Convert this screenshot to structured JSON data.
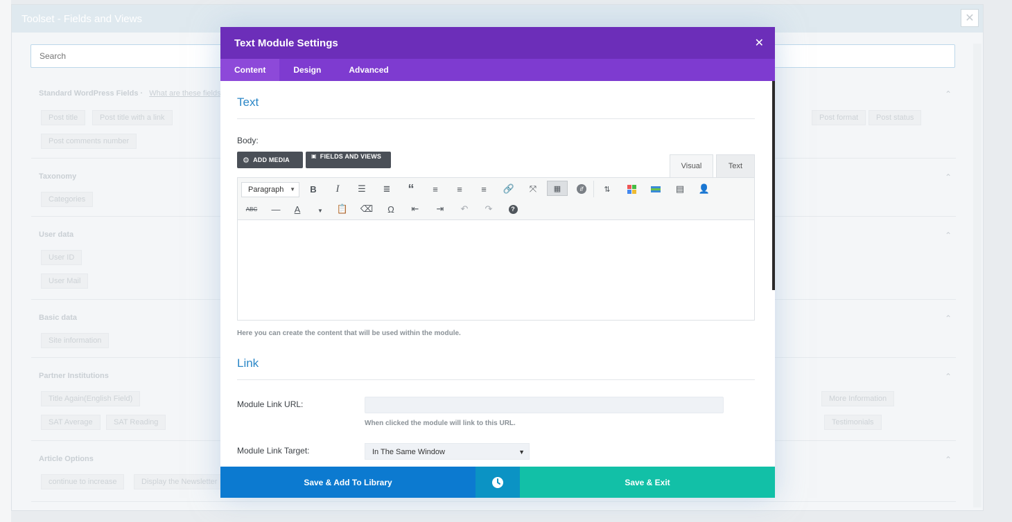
{
  "background_dialog": {
    "title": "Toolset - Fields and Views",
    "close_label": "✕",
    "search_placeholder": "Search",
    "sections": [
      {
        "title": "Standard WordPress Fields",
        "link": "What are these fields?",
        "chips": [
          "Post title",
          "Post title with a link",
          "Post comments number",
          "Post format",
          "Post status"
        ]
      },
      {
        "title": "Taxonomy",
        "chips": [
          "Categories"
        ]
      },
      {
        "title": "User data",
        "chips": [
          "User ID",
          "User Mail"
        ]
      },
      {
        "title": "Basic data",
        "chips": [
          "Site information"
        ]
      },
      {
        "title": "Partner Institutions",
        "chips": [
          "Title Again(English Field)",
          "More Information",
          "SAT Average",
          "SAT Reading",
          "Testimonials"
        ]
      },
      {
        "title": "Article Options",
        "chips": [
          "continue to increase",
          "Display the Newsletter"
        ]
      }
    ]
  },
  "modal": {
    "title": "Text Module Settings",
    "close_label": "✕",
    "tabs": [
      "Content",
      "Design",
      "Advanced"
    ],
    "active_tab": "Content",
    "text_section": {
      "heading": "Text",
      "body_label": "Body:",
      "add_media_label": "ADD MEDIA",
      "fields_views_label": "FIELDS AND VIEWS",
      "editor_tabs": {
        "visual": "Visual",
        "text": "Text"
      },
      "format_select_value": "Paragraph",
      "hint": "Here you can create the content that will be used within the module."
    },
    "link_section": {
      "heading": "Link",
      "url_label": "Module Link URL:",
      "url_value": "",
      "url_hint": "When clicked the module will link to this URL.",
      "target_label": "Module Link Target:",
      "target_value": "In The Same Window"
    },
    "footer": {
      "save_library_label": "Save & Add To Library",
      "save_exit_label": "Save & Exit"
    }
  },
  "toolbar_icons": {
    "row1": [
      "bold-icon",
      "italic-icon",
      "bullet-list-icon",
      "numbered-list-icon",
      "blockquote-icon",
      "align-left-icon",
      "align-center-icon",
      "align-right-icon",
      "link-icon",
      "fullscreen-icon",
      "toolbar-toggle-icon",
      "shortcode-icon",
      "insert-icon",
      "widget-icon",
      "layout-icon",
      "table-icon",
      "user-icon"
    ],
    "row2": [
      "strikethrough-icon",
      "horizontal-line-icon",
      "text-color-icon",
      "paste-text-icon",
      "clear-format-icon",
      "special-char-icon",
      "outdent-icon",
      "indent-icon",
      "undo-icon",
      "redo-icon",
      "help-icon"
    ]
  },
  "colors": {
    "header_purple": "#6c2eb9",
    "tab_purple": "#7e3bd0",
    "heading_blue": "#2b87c7",
    "save_library_blue": "#0c7ad0",
    "history_teal": "#0b93c4",
    "save_exit_green": "#12c0a7"
  }
}
